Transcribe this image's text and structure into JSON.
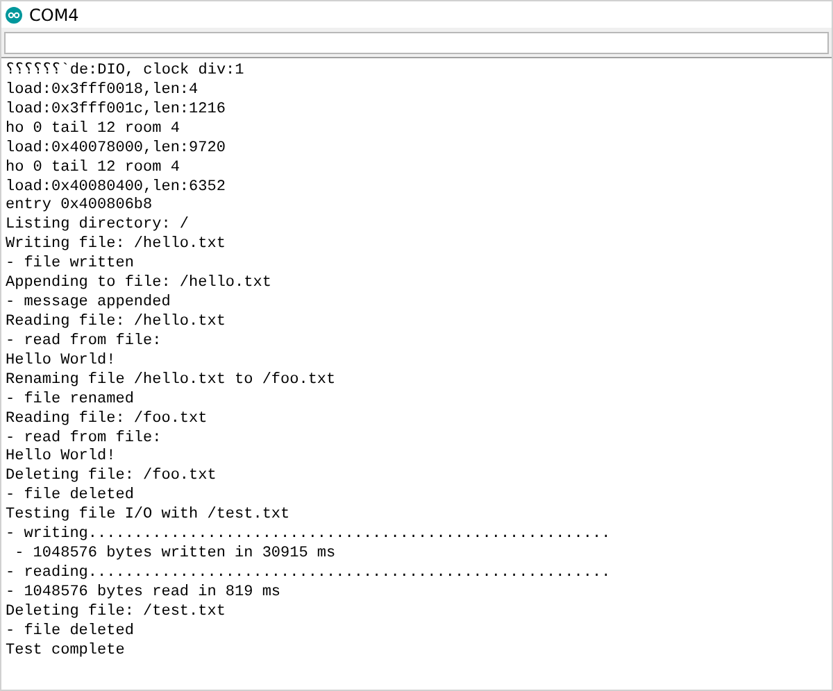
{
  "window": {
    "title": "COM4"
  },
  "output": {
    "lines": [
      "⸮⸮⸮⸮⸮⸮`de:DIO, clock div:1",
      "load:0x3fff0018,len:4",
      "load:0x3fff001c,len:1216",
      "ho 0 tail 12 room 4",
      "load:0x40078000,len:9720",
      "ho 0 tail 12 room 4",
      "load:0x40080400,len:6352",
      "entry 0x400806b8",
      "Listing directory: /",
      "Writing file: /hello.txt",
      "- file written",
      "Appending to file: /hello.txt",
      "- message appended",
      "Reading file: /hello.txt",
      "- read from file:",
      "Hello World!",
      "Renaming file /hello.txt to /foo.txt",
      "- file renamed",
      "Reading file: /foo.txt",
      "- read from file:",
      "Hello World!",
      "Deleting file: /foo.txt",
      "- file deleted",
      "Testing file I/O with /test.txt",
      "- writing.........................................................",
      " - 1048576 bytes written in 30915 ms",
      "- reading.........................................................",
      "- 1048576 bytes read in 819 ms",
      "Deleting file: /test.txt",
      "- file deleted",
      "Test complete"
    ]
  }
}
